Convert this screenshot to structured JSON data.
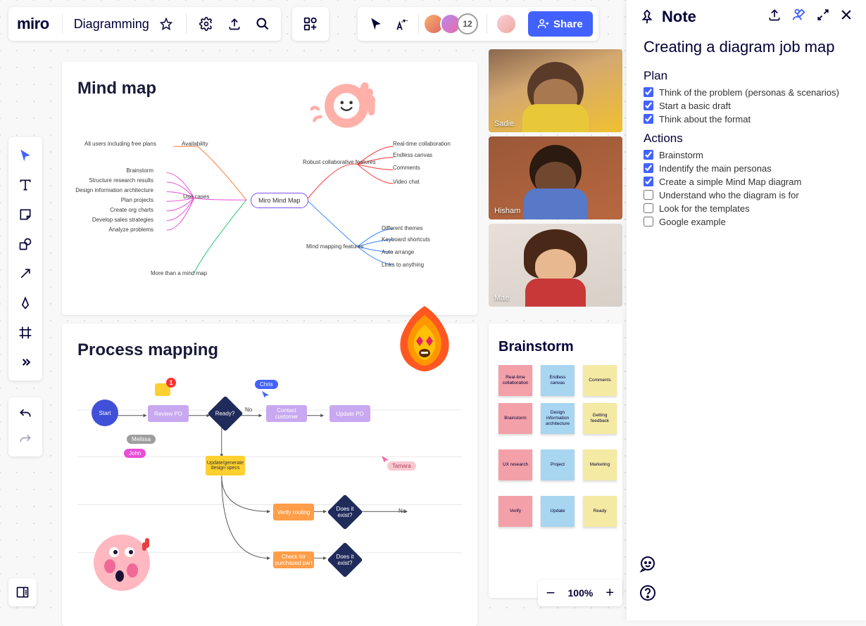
{
  "logo": "miro",
  "board_title": "Diagramming",
  "share_label": "Share",
  "participant_count": "12",
  "zoom_level": "100%",
  "videos": [
    {
      "name": "Sadie"
    },
    {
      "name": "Hisham"
    },
    {
      "name": "Mae"
    }
  ],
  "cards": {
    "mindmap": {
      "title": "Mind map",
      "center": "Miro Mind Map",
      "left_branches": {
        "availability": {
          "label": "Availability",
          "children": [
            "All users including free plans"
          ]
        },
        "use_cases": {
          "label": "Use cases",
          "children": [
            "Brainstorm",
            "Structure research results",
            "Design information architecture",
            "Plan projects",
            "Create org charts",
            "Develop sales strategies",
            "Analyze problems"
          ]
        },
        "more": {
          "label": "More than a mind map"
        }
      },
      "right_branches": {
        "collab": {
          "label": "Robust collaborative features",
          "children": [
            "Real-time collaboration",
            "Endless canvas",
            "Comments",
            "Video chat"
          ]
        },
        "mapping": {
          "label": "Mind mapping features",
          "children": [
            "Different themes",
            "Keyboard shortcuts",
            "Auto arrange",
            "Links to anything"
          ]
        }
      }
    },
    "process": {
      "title": "Process mapping",
      "nodes": {
        "start": "Start",
        "review": "Review PO",
        "ready": "Ready?",
        "contact": "Contact customer",
        "update": "Update PO",
        "generate": "Update/generate design specs",
        "verify": "Verify routing",
        "exist1": "Does it exist?",
        "check": "Check for purchased part",
        "exist2": "Does it exist?",
        "no": "No",
        "no2": "No"
      },
      "tags": {
        "chris": "Chris",
        "melissa": "Melissa",
        "john": "John",
        "tamara": "Tamara"
      },
      "badge": "1"
    },
    "brainstorm": {
      "title": "Brainstorm",
      "stickies": [
        {
          "text": "Real-time collaboration",
          "c": "pink"
        },
        {
          "text": "Endless canvas",
          "c": "blue"
        },
        {
          "text": "Comments",
          "c": "yellow"
        },
        {
          "text": "Brainstorm",
          "c": "pink"
        },
        {
          "text": "Design information architecture",
          "c": "blue"
        },
        {
          "text": "Getting feedback",
          "c": "yellow"
        },
        {
          "text": "UX research",
          "c": "pink"
        },
        {
          "text": "Project",
          "c": "blue"
        },
        {
          "text": "Marketing",
          "c": "yellow"
        },
        {
          "text": "Verify",
          "c": "pink"
        },
        {
          "text": "Update",
          "c": "blue"
        },
        {
          "text": "Ready",
          "c": "yellow"
        }
      ]
    }
  },
  "note": {
    "label": "Note",
    "title": "Creating a diagram job map",
    "sections": {
      "plan": {
        "title": "Plan",
        "items": [
          {
            "text": "Think of the problem (personas & scenarios)",
            "checked": true
          },
          {
            "text": "Start a basic draft",
            "checked": true
          },
          {
            "text": "Think about the format",
            "checked": true
          }
        ]
      },
      "actions": {
        "title": "Actions",
        "items": [
          {
            "text": "Brainstorm",
            "checked": true
          },
          {
            "text": "Indentify the main personas",
            "checked": true
          },
          {
            "text": "Create a simple Mind Map diagram",
            "checked": true
          },
          {
            "text": "Understand who the diagram is for",
            "checked": false
          },
          {
            "text": "Look for the templates",
            "checked": false
          },
          {
            "text": "Google example",
            "checked": false
          }
        ]
      }
    }
  },
  "colors": {
    "accent": "#4262ff",
    "purple": "#b18bf0",
    "yellow": "#ffd02f",
    "orange": "#ff9d48",
    "navy": "#1f2b5b"
  }
}
